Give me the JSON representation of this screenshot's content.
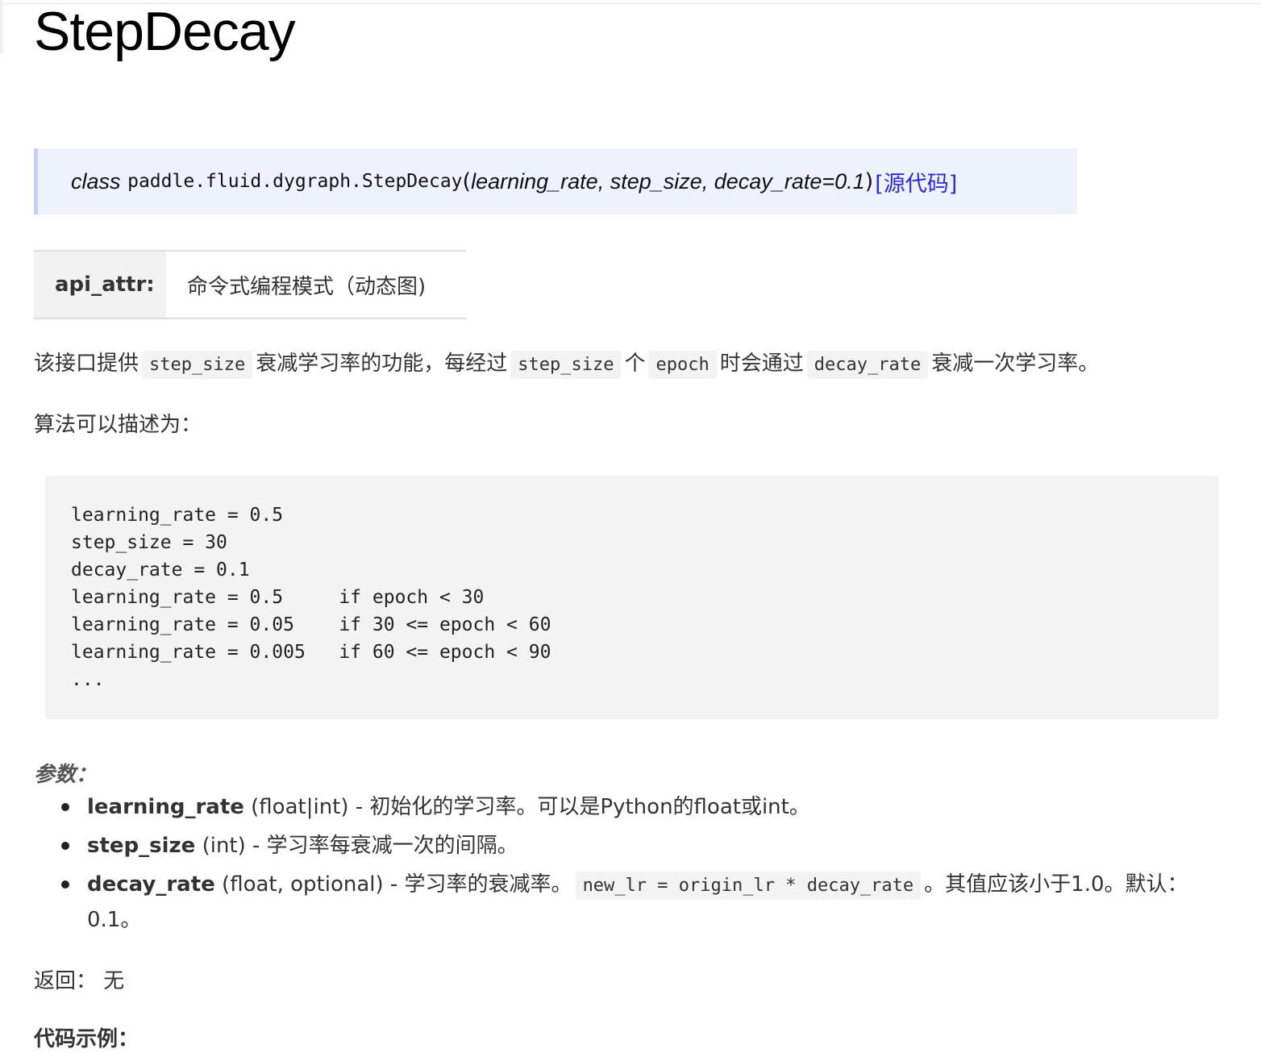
{
  "title": "StepDecay",
  "signature": {
    "keyword": "class",
    "path": "paddle.fluid.dygraph.StepDecay",
    "open_paren": "(",
    "params": "learning_rate, step_size, decay_rate=0.1",
    "close_paren": ")",
    "source_link": "[源代码]"
  },
  "api_attr": {
    "label": "api_attr:",
    "value": "命令式编程模式（动态图)"
  },
  "description": {
    "t1": "该接口提供",
    "c1": "step_size",
    "t2": "衰减学习率的功能，每经过",
    "c2": "step_size",
    "t3": "个",
    "c3": "epoch",
    "t4": "时会通过",
    "c4": "decay_rate",
    "t5": "衰减一次学习率。"
  },
  "algo_intro": "算法可以描述为：",
  "code_block": "learning_rate = 0.5\nstep_size = 30\ndecay_rate = 0.1\nlearning_rate = 0.5     if epoch < 30\nlearning_rate = 0.05    if 30 <= epoch < 60\nlearning_rate = 0.005   if 60 <= epoch < 90\n...",
  "params_heading": "参数：",
  "params": [
    {
      "name": "learning_rate",
      "desc": "(float|int) - 初始化的学习率。可以是Python的float或int。"
    },
    {
      "name": "step_size",
      "desc": "(int) - 学习率每衰减一次的间隔。"
    },
    {
      "name": "decay_rate",
      "desc_pre": "(float, optional) - 学习率的衰减率。",
      "code": "new_lr = origin_lr * decay_rate",
      "desc_post": "。其值应该小于1.0。默认：0.1。"
    }
  ],
  "returns": "返回： 无",
  "example_heading": "代码示例："
}
